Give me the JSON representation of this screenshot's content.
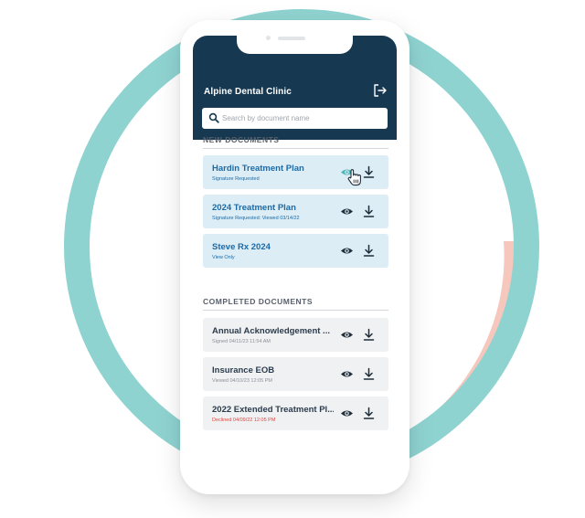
{
  "app": {
    "title": "Alpine Dental Clinic",
    "logout_icon": "logout-icon"
  },
  "search": {
    "placeholder": "Search by document name",
    "value": ""
  },
  "new_section": {
    "title": "NEW DOCUMENTS",
    "items": [
      {
        "title": "Hardin Treatment Plan",
        "subtitle": "Signature Requested"
      },
      {
        "title": "2024 Treatment Plan",
        "subtitle": "Signature Requested: Viewed 03/14/22"
      },
      {
        "title": "Steve Rx 2024",
        "subtitle": "View Only"
      }
    ]
  },
  "completed_section": {
    "title": "COMPLETED DOCUMENTS",
    "items": [
      {
        "title": "Annual Acknowledgement ...",
        "subtitle": "Signed 04/11/23 11:54 AM"
      },
      {
        "title": "Insurance EOB",
        "subtitle": "Viewed 04/10/23 12:05 PM"
      },
      {
        "title": "2022 Extended Treatment Pl...",
        "subtitle": "Declined 04/09/22 12:05 PM",
        "status": "declined"
      }
    ]
  },
  "icons": {
    "view": "eye-icon",
    "download": "download-icon",
    "search": "search-icon",
    "cursor": "hand-pointer-cursor"
  },
  "colors": {
    "header_bg": "#173851",
    "new_doc_bg": "#dcedf6",
    "new_doc_text": "#1c6aa6",
    "completed_doc_bg": "#eff1f3",
    "declined": "#e2453d",
    "ring_teal": "#8fd3d1",
    "ring_salmon": "#f5c7bd",
    "eye_hover": "#49b7b5"
  }
}
